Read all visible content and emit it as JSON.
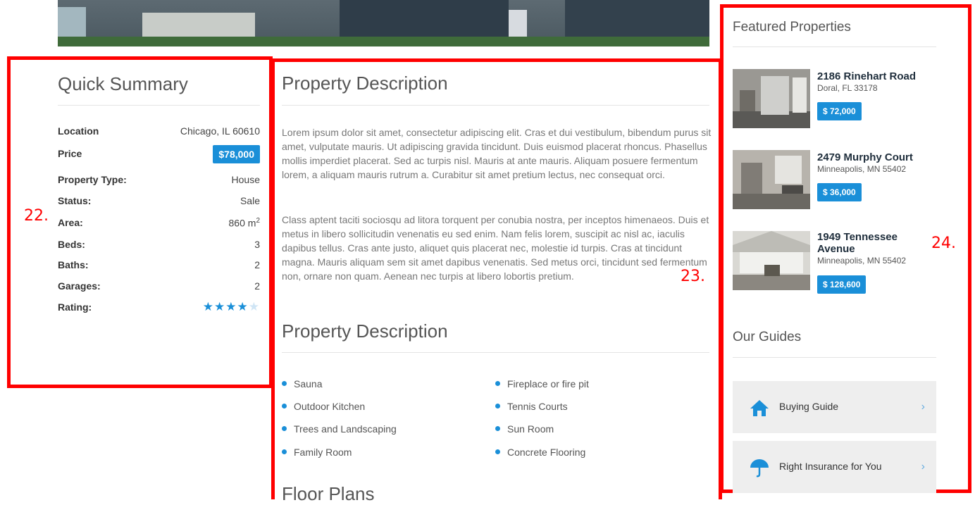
{
  "annotations": {
    "n22": "22.",
    "n23": "23.",
    "n24": "24."
  },
  "quick_summary": {
    "title": "Quick Summary",
    "rows": [
      {
        "label": "Location",
        "value": "Chicago, IL 60610"
      },
      {
        "label": "Price",
        "value": "$78,000"
      },
      {
        "label": "Property Type:",
        "value": "House"
      },
      {
        "label": "Status:",
        "value": "Sale"
      },
      {
        "label": "Area:",
        "value": "860 m",
        "sup": "2"
      },
      {
        "label": "Beds:",
        "value": "3"
      },
      {
        "label": "Baths:",
        "value": "2"
      },
      {
        "label": "Garages:",
        "value": "2"
      },
      {
        "label": "Rating:",
        "rating": 4,
        "rating_max": 5
      }
    ]
  },
  "description": {
    "title": "Property Description",
    "p1": "Lorem ipsum dolor sit amet, consectetur adipiscing elit. Cras et dui vestibulum, bibendum purus sit amet, vulputate mauris. Ut adipiscing gravida tincidunt. Duis euismod placerat rhoncus. Phasellus mollis imperdiet placerat. Sed ac turpis nisl. Mauris at ante mauris. Aliquam posuere fermentum lorem, a aliquam mauris rutrum a. Curabitur sit amet pretium lectus, nec consequat orci.",
    "p2": "Class aptent taciti sociosqu ad litora torquent per conubia nostra, per inceptos himenaeos. Duis et metus in libero sollicitudin venenatis eu sed enim. Nam felis lorem, suscipit ac nisl ac, iaculis dapibus tellus. Cras ante justo, aliquet quis placerat nec, molestie id turpis. Cras at tincidunt magna. Mauris aliquam sem sit amet dapibus venenatis. Sed metus orci, tincidunt sed fermentum non, ornare non quam. Aenean nec turpis at libero lobortis pretium.",
    "features_title": "Property Description",
    "features_left": [
      "Sauna",
      "Outdoor Kitchen",
      "Trees and Landscaping",
      "Family Room"
    ],
    "features_right": [
      "Fireplace or fire pit",
      "Tennis Courts",
      "Sun Room",
      "Concrete Flooring"
    ],
    "floor_plans_title": "Floor Plans"
  },
  "sidebar": {
    "featured_title": "Featured Properties",
    "properties": [
      {
        "name": "2186 Rinehart Road",
        "address": "Doral, FL 33178",
        "price": "$ 72,000"
      },
      {
        "name": "2479 Murphy Court",
        "address": "Minneapolis, MN 55402",
        "price": "$ 36,000"
      },
      {
        "name": "1949 Tennessee Avenue",
        "address": "Minneapolis, MN 55402",
        "price": "$ 128,600"
      }
    ],
    "guides_title": "Our Guides",
    "guides": [
      {
        "label": "Buying Guide",
        "icon": "home-icon"
      },
      {
        "label": "Right Insurance for You",
        "icon": "umbrella-icon"
      }
    ]
  },
  "colors": {
    "accent": "#1a8fd8",
    "annotation": "#ff0000"
  }
}
